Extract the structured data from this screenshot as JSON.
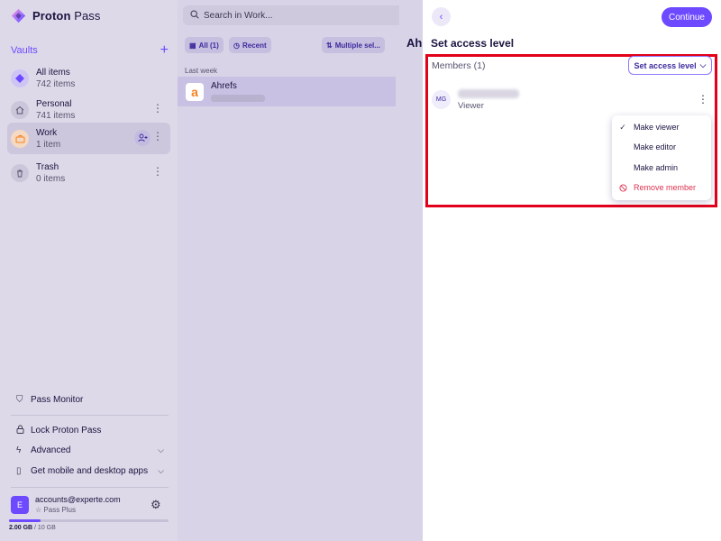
{
  "brand": {
    "name_bold": "Proton",
    "name_light": " Pass"
  },
  "sidebar": {
    "vaults_title": "Vaults",
    "vaults": [
      {
        "name": "All items",
        "count": "742 items",
        "icon": "diamond-icon",
        "color": "#6d4aff"
      },
      {
        "name": "Personal",
        "count": "741 items",
        "icon": "house-icon",
        "color": "#8a8aa0"
      },
      {
        "name": "Work",
        "count": "1 item",
        "icon": "briefcase-icon",
        "color": "#f58220"
      },
      {
        "name": "Trash",
        "count": "0 items",
        "icon": "trash-icon",
        "color": "#8a8aa0"
      }
    ],
    "links": {
      "pass_monitor": "Pass Monitor",
      "lock": "Lock Proton Pass",
      "advanced": "Advanced",
      "get_apps": "Get mobile and desktop apps"
    },
    "account": {
      "initial": "E",
      "email": "accounts@experte.com",
      "plan": "Pass Plus"
    },
    "storage": {
      "used": "2.00 GB",
      "total": "/ 10 GB",
      "fraction": 0.2
    }
  },
  "list": {
    "search_placeholder": "Search in Work...",
    "chips": {
      "all": "All (1)",
      "recent": "Recent",
      "multiple": "Multiple sel..."
    },
    "section": "Last week",
    "items": [
      {
        "title": "Ahrefs",
        "logo": "a"
      }
    ]
  },
  "detail": {
    "title": "Ah"
  },
  "drawer": {
    "continue_label": "Continue",
    "title": "Set access level",
    "members_title": "Members (1)",
    "access_button": "Set access level",
    "member": {
      "initials": "MG",
      "role": "Viewer"
    },
    "menu": {
      "make_viewer": "Make viewer",
      "make_editor": "Make editor",
      "make_admin": "Make admin",
      "remove_member": "Remove member"
    }
  },
  "colors": {
    "accent": "#6d4aff",
    "danger": "#dc3251",
    "highlight": "#e2001a"
  }
}
